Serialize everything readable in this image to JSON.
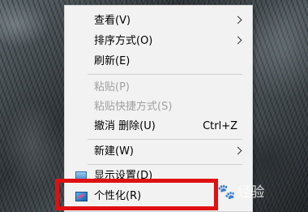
{
  "menu": {
    "items": [
      {
        "label": "查看(V)",
        "has_submenu": true
      },
      {
        "label": "排序方式(O)",
        "has_submenu": true
      },
      {
        "label": "刷新(E)"
      },
      {
        "label": "粘贴(P)",
        "disabled": true
      },
      {
        "label": "粘贴快捷方式(S)",
        "disabled": true
      },
      {
        "label": "撤消 删除(U)",
        "shortcut": "Ctrl+Z"
      },
      {
        "label": "新建(W)",
        "has_submenu": true
      },
      {
        "label": "显示设置(D)",
        "icon": "display-settings-icon"
      },
      {
        "label": "个性化(R)",
        "icon": "personalize-icon"
      }
    ]
  },
  "highlight_color": "#e01010",
  "watermark": {
    "text": "经验",
    "icon": "baidu-paw-icon"
  }
}
